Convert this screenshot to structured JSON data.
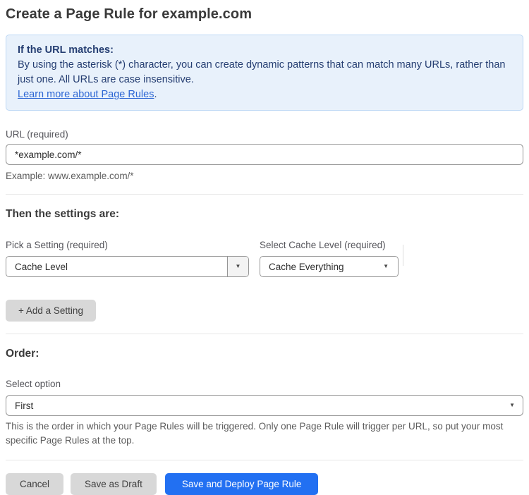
{
  "page": {
    "title": "Create a Page Rule for example.com"
  },
  "info_box": {
    "heading": "If the URL matches:",
    "body": "By using the asterisk (*) character, you can create dynamic patterns that can match many URLs, rather than just one. All URLs are case insensitive.",
    "link_label": "Learn more about Page Rules",
    "link_suffix": "."
  },
  "url_field": {
    "label": "URL (required)",
    "value": "*example.com/*",
    "helper": "Example: www.example.com/*"
  },
  "settings": {
    "heading": "Then the settings are:",
    "pick_setting": {
      "label": "Pick a Setting (required)",
      "value": "Cache Level"
    },
    "cache_level": {
      "label": "Select Cache Level (required)",
      "value": "Cache Everything"
    },
    "add_button_label": "+ Add a Setting"
  },
  "order": {
    "heading": "Order:",
    "label": "Select option",
    "value": "First",
    "helper": "This is the order in which your Page Rules will be triggered. Only one Page Rule will trigger per URL, so put your most specific Page Rules at the top."
  },
  "actions": {
    "cancel_label": "Cancel",
    "save_draft_label": "Save as Draft",
    "save_deploy_label": "Save and Deploy Page Rule"
  },
  "icons": {
    "dropdown_arrow": "▼"
  },
  "colors": {
    "accent_blue": "#2270f2",
    "info_bg": "#e8f1fb",
    "info_border": "#bed8f5",
    "info_text": "#253e72",
    "link_blue": "#2c66d4"
  }
}
